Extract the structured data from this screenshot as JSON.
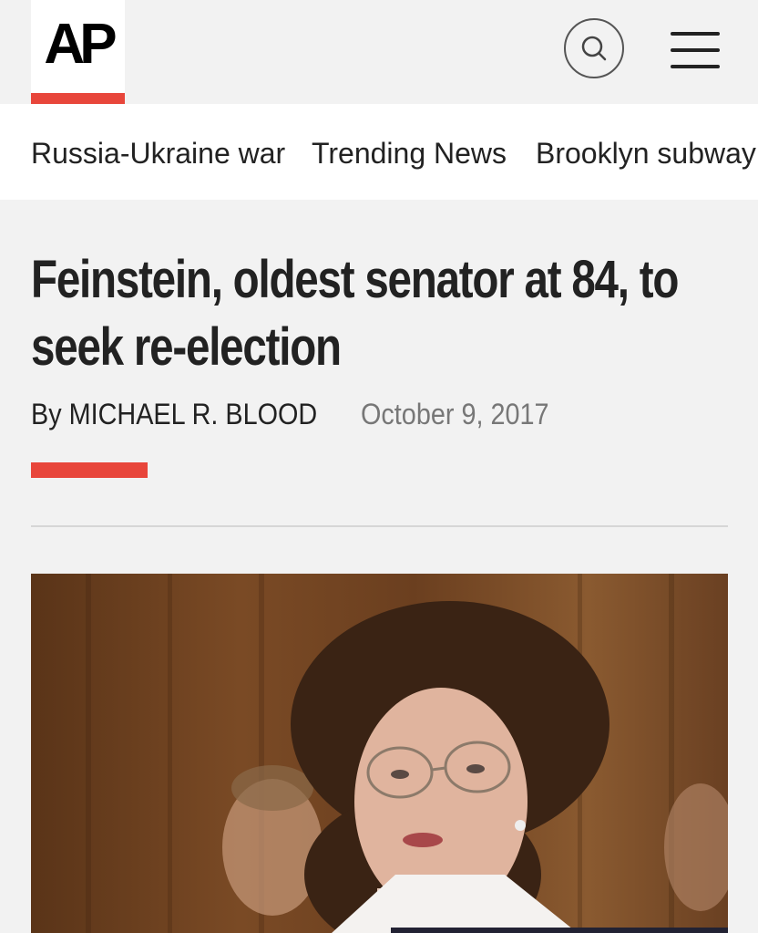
{
  "brand": {
    "logo_text": "AP",
    "accent_color": "#e8463b"
  },
  "header": {
    "search_icon": "search-icon",
    "menu_icon": "hamburger-menu-icon"
  },
  "nav": {
    "items": [
      {
        "label": "Russia-Ukraine war"
      },
      {
        "label": "Trending News"
      },
      {
        "label": "Brooklyn subway"
      }
    ]
  },
  "article": {
    "headline": "Feinstein, oldest senator at 84, to seek re-election",
    "byline": "By MICHAEL R. BLOOD",
    "date": "October 9, 2017"
  }
}
